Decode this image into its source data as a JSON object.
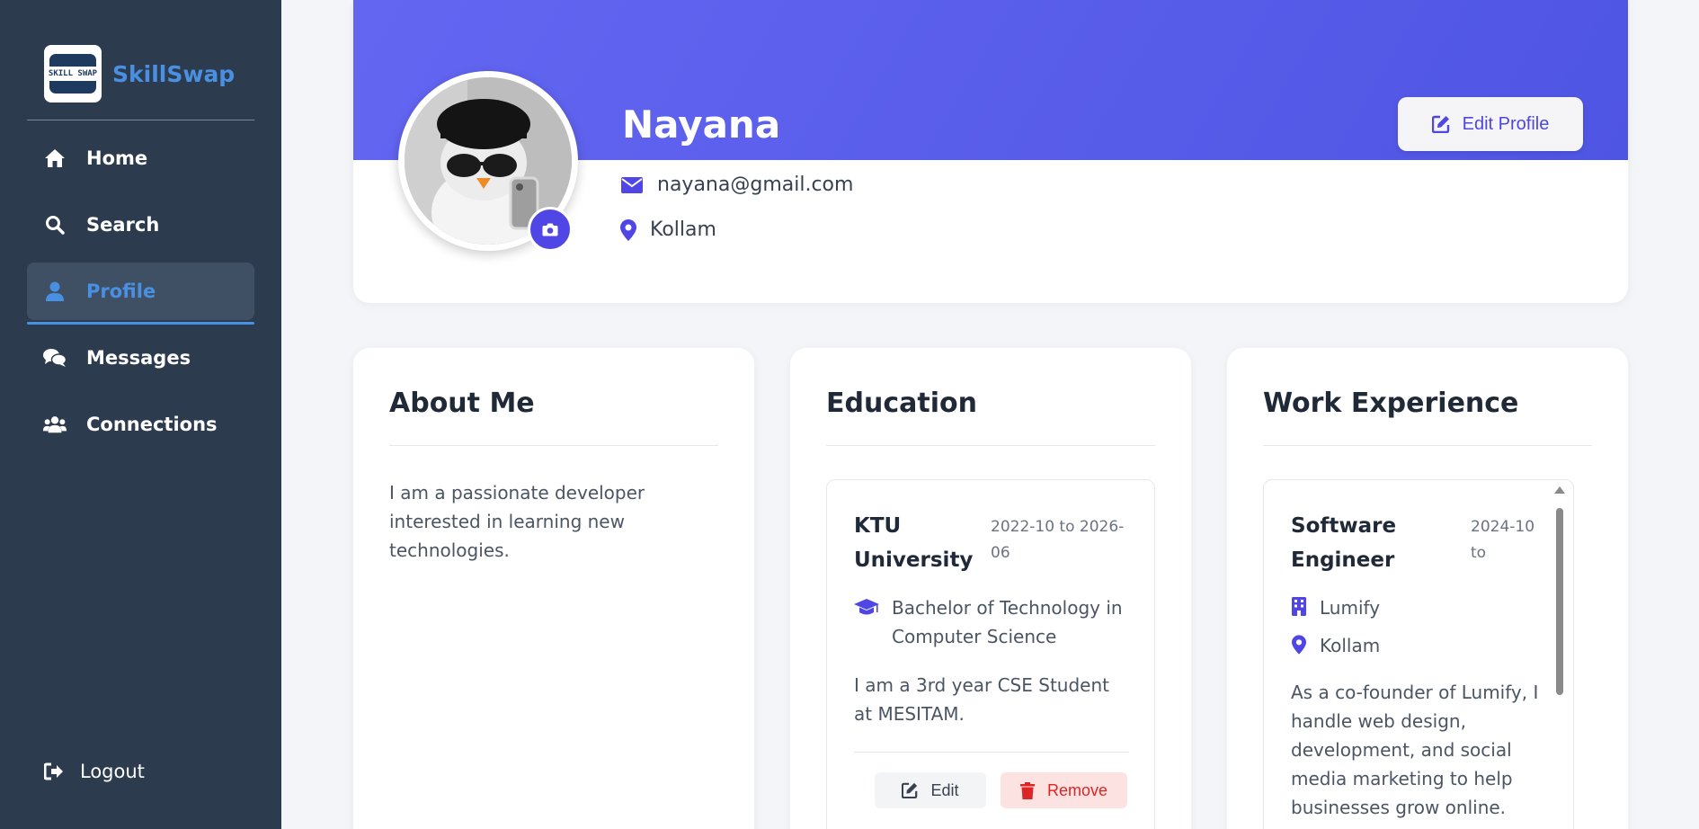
{
  "app": {
    "logo_text": "SKILL SWAP",
    "name": "SkillSwap"
  },
  "sidebar": {
    "items": [
      {
        "label": "Home",
        "icon": "home-icon"
      },
      {
        "label": "Search",
        "icon": "search-icon"
      },
      {
        "label": "Profile",
        "icon": "user-icon",
        "active": true
      },
      {
        "label": "Messages",
        "icon": "chat-icon"
      },
      {
        "label": "Connections",
        "icon": "users-icon"
      }
    ],
    "logout_label": "Logout"
  },
  "profile": {
    "name": "Nayana",
    "email": "nayana@gmail.com",
    "location": "Kollam",
    "edit_label": "Edit Profile"
  },
  "about": {
    "title": "About Me",
    "text": "I am a passionate developer interested in learning new technologies."
  },
  "education": {
    "title": "Education",
    "entry": {
      "institution": "KTU University",
      "dates": "2022-10 to 2026-06",
      "degree": "Bachelor of Technology in Computer Science",
      "description": "I am a 3rd year CSE Student at MESITAM.",
      "edit_label": "Edit",
      "remove_label": "Remove"
    }
  },
  "work": {
    "title": "Work Experience",
    "entry": {
      "role": "Software Engineer",
      "dates": "2024-10 to",
      "company": "Lumify",
      "location": "Kollam",
      "description": "As a co-founder of Lumify, I handle web design, development, and social media marketing to help businesses grow online."
    }
  },
  "colors": {
    "sidebar": "#2d3b4e",
    "accent": "#4a90e2",
    "primary": "#4f46e5",
    "banner": "#5b5fe9",
    "danger": "#dc2626"
  }
}
